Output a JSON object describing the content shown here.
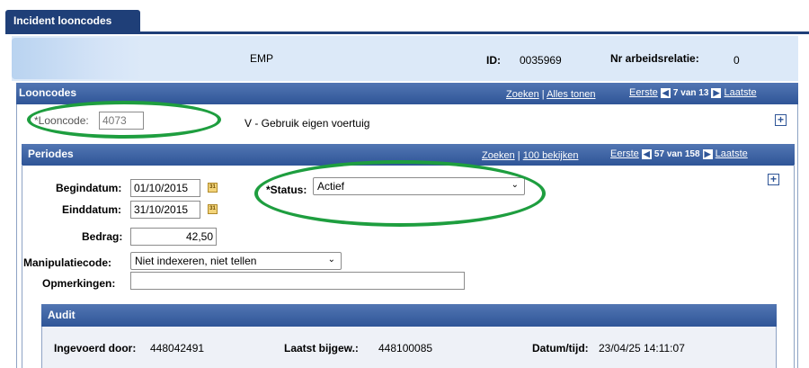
{
  "tab": {
    "label": "Incident looncodes"
  },
  "header": {
    "emp_label": "EMP",
    "id_label": "ID:",
    "id_value": "0035969",
    "nr_label": "Nr arbeidsrelatie:",
    "nr_value": "0"
  },
  "looncodes": {
    "title": "Looncodes",
    "find": "Zoeken",
    "sep": "|",
    "show_all": "Alles tonen",
    "first": "Eerste",
    "count": "7 van 13",
    "last": "Laatste",
    "code_label": "*Looncode:",
    "code_value": "4073",
    "description": "V - Gebruik eigen voertuig"
  },
  "periodes": {
    "title": "Periodes",
    "find": "Zoeken",
    "sep": "|",
    "view100": "100 bekijken",
    "first": "Eerste",
    "count": "57 van 158",
    "last": "Laatste",
    "begin_label": "Begindatum:",
    "begin_value": "01/10/2015",
    "end_label": "Einddatum:",
    "end_value": "31/10/2015",
    "amount_label": "Bedrag:",
    "amount_value": "42,50",
    "manip_label": "Manipulatiecode:",
    "manip_value": "Niet indexeren, niet tellen",
    "remarks_label": "Opmerkingen:",
    "remarks_value": "",
    "status_label": "*Status:",
    "status_value": "Actief"
  },
  "audit": {
    "title": "Audit",
    "entered_label": "Ingevoerd door:",
    "entered_value": "448042491",
    "updated_label": "Laatst bijgew.:",
    "updated_value": "448100085",
    "datetime_label": "Datum/tijd:",
    "datetime_value": "23/04/25 14:11:07"
  },
  "colors": {
    "accent": "#2f5597",
    "header_bg": "#dce9f8",
    "highlight": "#1e9e3f"
  },
  "icons": {
    "prev": "triangle-left-icon",
    "next": "triangle-right-icon",
    "calendar": "calendar-icon",
    "add": "plus-icon",
    "dropdown": "chevron-down-icon"
  }
}
